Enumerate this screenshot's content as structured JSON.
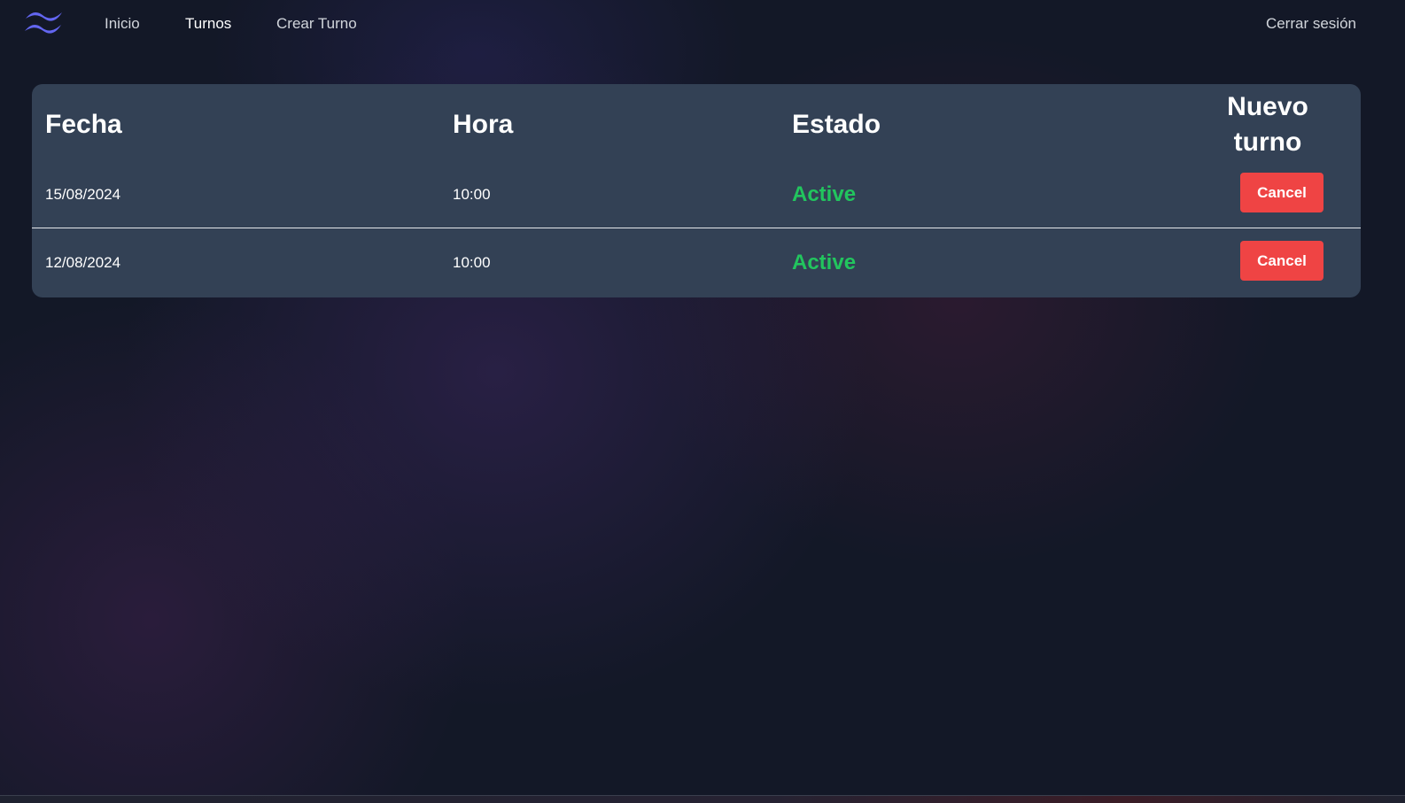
{
  "nav": {
    "logo_icon": "tailwind-wave-logo-icon",
    "logo_color": "#6366f1",
    "links": [
      {
        "label": "Inicio",
        "active": false
      },
      {
        "label": "Turnos",
        "active": true
      },
      {
        "label": "Crear Turno",
        "active": false
      }
    ],
    "logout_label": "Cerrar sesión"
  },
  "table": {
    "headers": {
      "fecha": "Fecha",
      "hora": "Hora",
      "estado": "Estado",
      "nuevo_turno": "Nuevo turno"
    },
    "rows": [
      {
        "fecha": "15/08/2024",
        "hora": "10:00",
        "estado": "Active",
        "action": "Cancel"
      },
      {
        "fecha": "12/08/2024",
        "hora": "10:00",
        "estado": "Active",
        "action": "Cancel"
      }
    ]
  },
  "colors": {
    "background": "#131827",
    "card": "#334155",
    "status_active": "#22c55e",
    "cancel_button": "#ef4444"
  }
}
